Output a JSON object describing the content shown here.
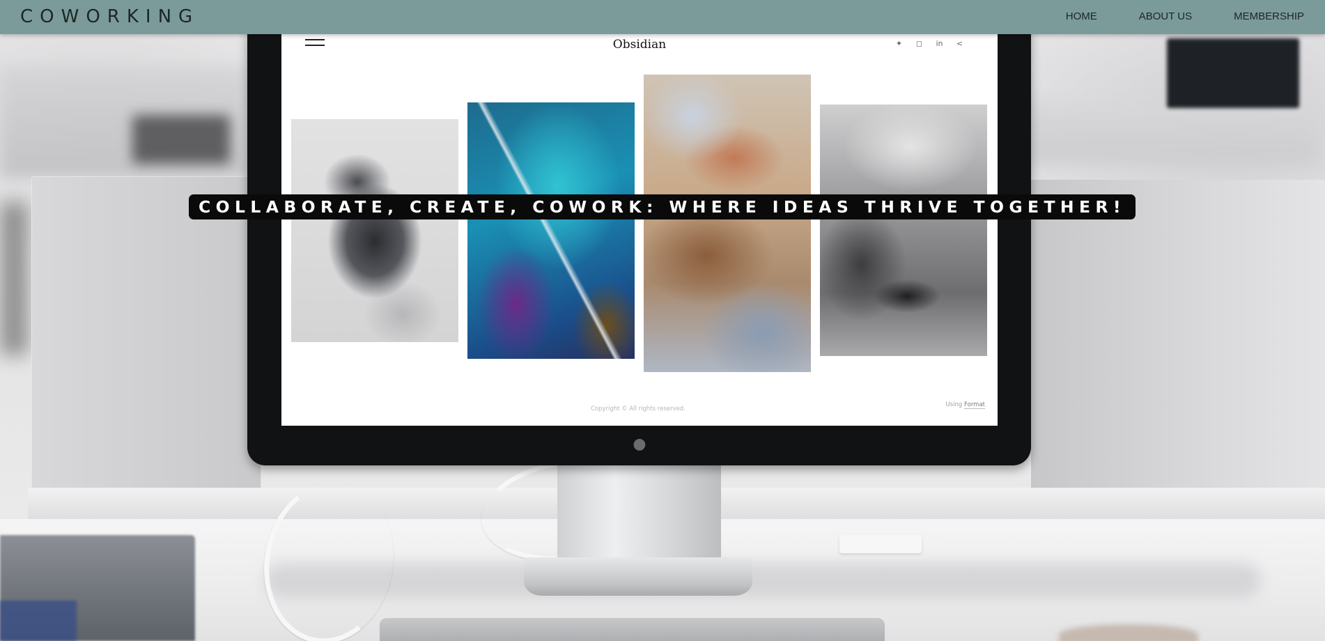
{
  "header": {
    "brand": "COWORKING",
    "nav": [
      {
        "label": "HOME"
      },
      {
        "label": "ABOUT US"
      },
      {
        "label": "MEMBERSHIP"
      }
    ]
  },
  "hero": {
    "tagline": "COLLABORATE, CREATE, COWORK: WHERE IDEAS THRIVE TOGETHER!"
  },
  "screen_site": {
    "brand": "Obsidian",
    "social_icons": [
      "twitter-icon",
      "instagram-icon",
      "linkedin-icon",
      "share-icon"
    ],
    "footer_copyright": "Copyright © All rights reserved.",
    "footer_using_prefix": "Using",
    "footer_using_link": "Format"
  },
  "colors": {
    "navbar": "#7b9b9b",
    "tagline_bg": "#0a0a0a",
    "tagline_text": "#ffffff"
  }
}
